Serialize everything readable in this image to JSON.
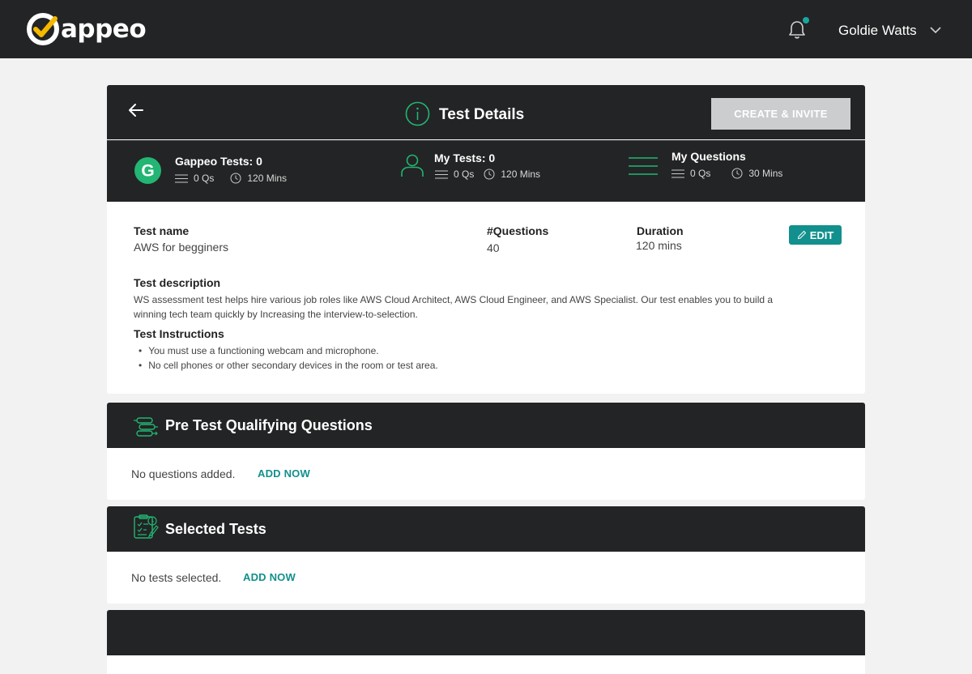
{
  "header": {
    "logo_text": "appeo",
    "user_name": "Goldie Watts",
    "colors": {
      "bar": "#232425",
      "accent": "#1ba5a0",
      "logo_check": "#f5b800"
    }
  },
  "details": {
    "title": "Test Details",
    "create_invite_label": "CREATE & INVITE",
    "stats": [
      {
        "title": "Gappeo Tests: 0",
        "qs": "0 Qs",
        "mins": "120 Mins",
        "icon": "gappeo-g-icon"
      },
      {
        "title": "My Tests: 0",
        "qs": "0 Qs",
        "mins": "120 Mins",
        "icon": "user-icon"
      },
      {
        "title": "My Questions",
        "qs": "0 Qs",
        "mins": "30 Mins",
        "icon": "list-lines-icon"
      }
    ],
    "gappeo_letter": "G",
    "test_name_label": "Test name",
    "test_name_value": "AWS for begginers",
    "questions_label": "#Questions",
    "questions_value": "40",
    "duration_label": "Duration",
    "duration_value": "120 mins",
    "edit_label": "EDIT",
    "description_label": "Test description",
    "description_value": "WS assessment test helps hire various job roles like AWS Cloud Architect, AWS Cloud Engineer, and AWS Specialist. Our test enables you to build a winning tech team quickly by Increasing the interview-to-selection.",
    "instructions_label": "Test Instructions",
    "instructions": [
      "You must use a functioning webcam and microphone.",
      "No cell phones or other secondary devices in the room or test area."
    ]
  },
  "pre_test": {
    "title": "Pre Test Qualifying Questions",
    "empty_text": "No questions added.",
    "add_label": "ADD NOW"
  },
  "selected_tests": {
    "title": "Selected Tests",
    "empty_text": "No tests selected.",
    "add_label": "ADD NOW"
  },
  "accent_color": "#11908d",
  "icon_green": "#22b573"
}
